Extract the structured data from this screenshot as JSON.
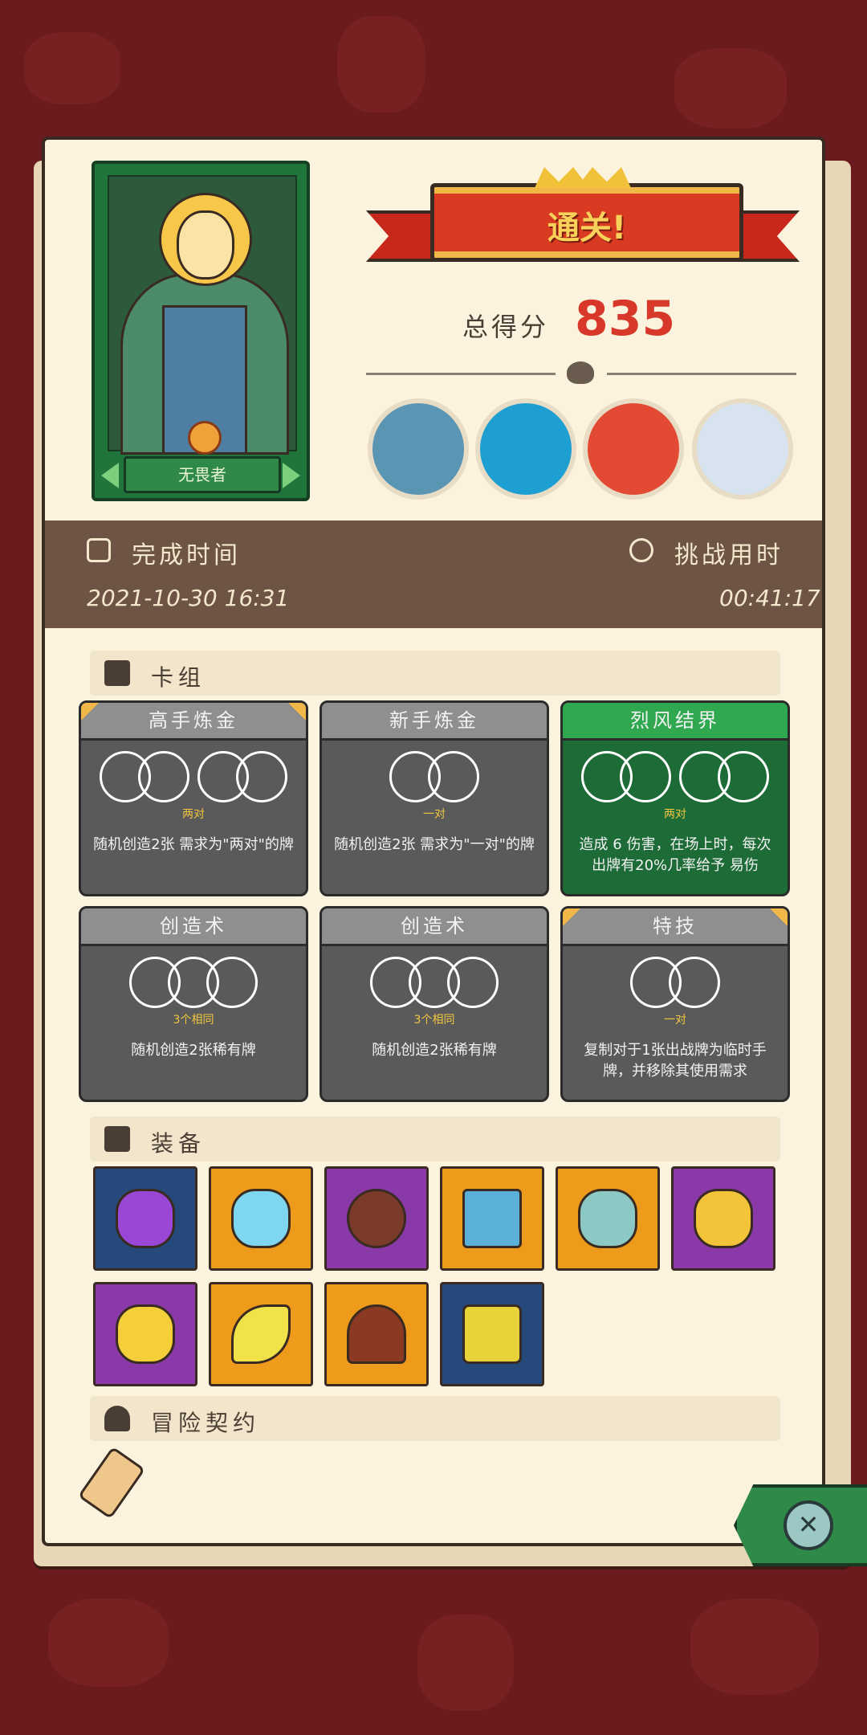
{
  "hero": {
    "name": "无畏者"
  },
  "banner": {
    "title": "通关!"
  },
  "score": {
    "label": "总得分",
    "value": "835"
  },
  "bosses": [
    "boss-1",
    "boss-2",
    "boss-3",
    "boss-4"
  ],
  "info": {
    "completion_label": "完成时间",
    "completion_value": "2021-10-30  16:31",
    "duration_label": "挑战用时",
    "duration_value": "00:41:17"
  },
  "sections": {
    "deck": "卡组",
    "equipment": "装备",
    "contract": "冒险契约"
  },
  "deck": [
    {
      "title": "高手炼金",
      "req": "两对",
      "desc": "随机创造2张 需求为\"两对\"的牌"
    },
    {
      "title": "新手炼金",
      "req": "一对",
      "desc": "随机创造2张 需求为\"一对\"的牌"
    },
    {
      "title": "烈风结界",
      "req": "两对",
      "desc": "造成 6 伤害，在场上时，每次出牌有20%几率给予 易伤"
    },
    {
      "title": "创造术",
      "req": "3个相同",
      "desc": "随机创造2张稀有牌"
    },
    {
      "title": "创造术",
      "req": "3个相同",
      "desc": "随机创造2张稀有牌"
    },
    {
      "title": "特技",
      "req": "一对",
      "desc": "复制对于1张出战牌为临时手牌，并移除其使用需求"
    }
  ],
  "colors": {
    "accent_red": "#d8382a",
    "card_bg": "#fbf3de",
    "band_brown": "#6d5444"
  }
}
